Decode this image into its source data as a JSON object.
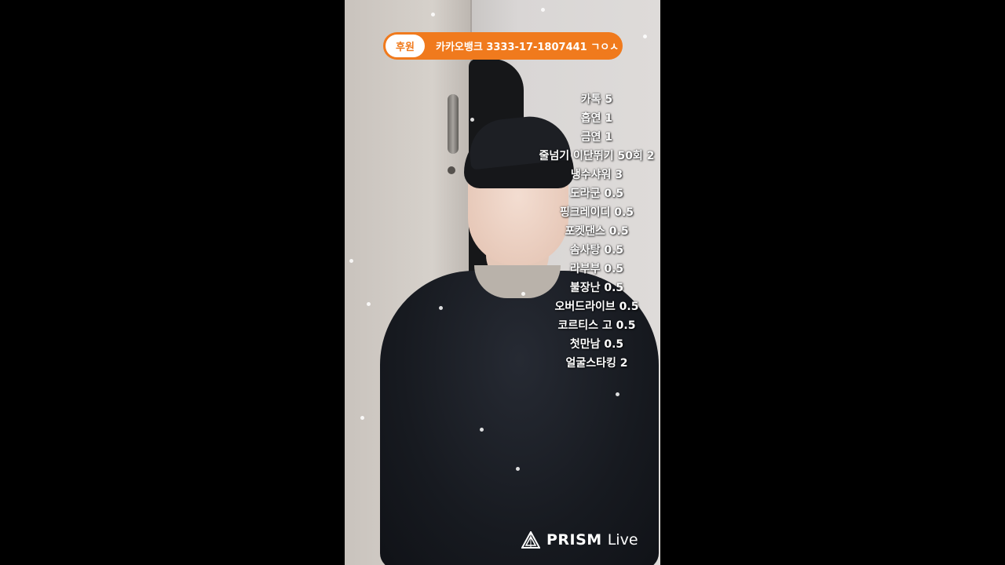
{
  "donation_banner": {
    "tag_label": "후원",
    "account_text": "카카오뱅크 3333-17-1807441 ㄱㅇㅅ",
    "accent_color": "#f07a1d"
  },
  "mission_list": [
    "카톡 5",
    "흡연 1",
    "금연 1",
    "줄넘기 이단뛰기 50회 2",
    "냉수샤워 3",
    "도라군 0.5",
    "핑크레이디 0.5",
    "포켓댄스 0.5",
    "솜사탕 0.5",
    "라부부 0.5",
    "불장난 0.5",
    "오버드라이브 0.5",
    "코르티스 고 0.5",
    "첫만남 0.5",
    "얼굴스타킹 2"
  ],
  "watermark": {
    "brand": "PRISM",
    "suffix": "Live",
    "icon": "prism-logo-icon"
  }
}
